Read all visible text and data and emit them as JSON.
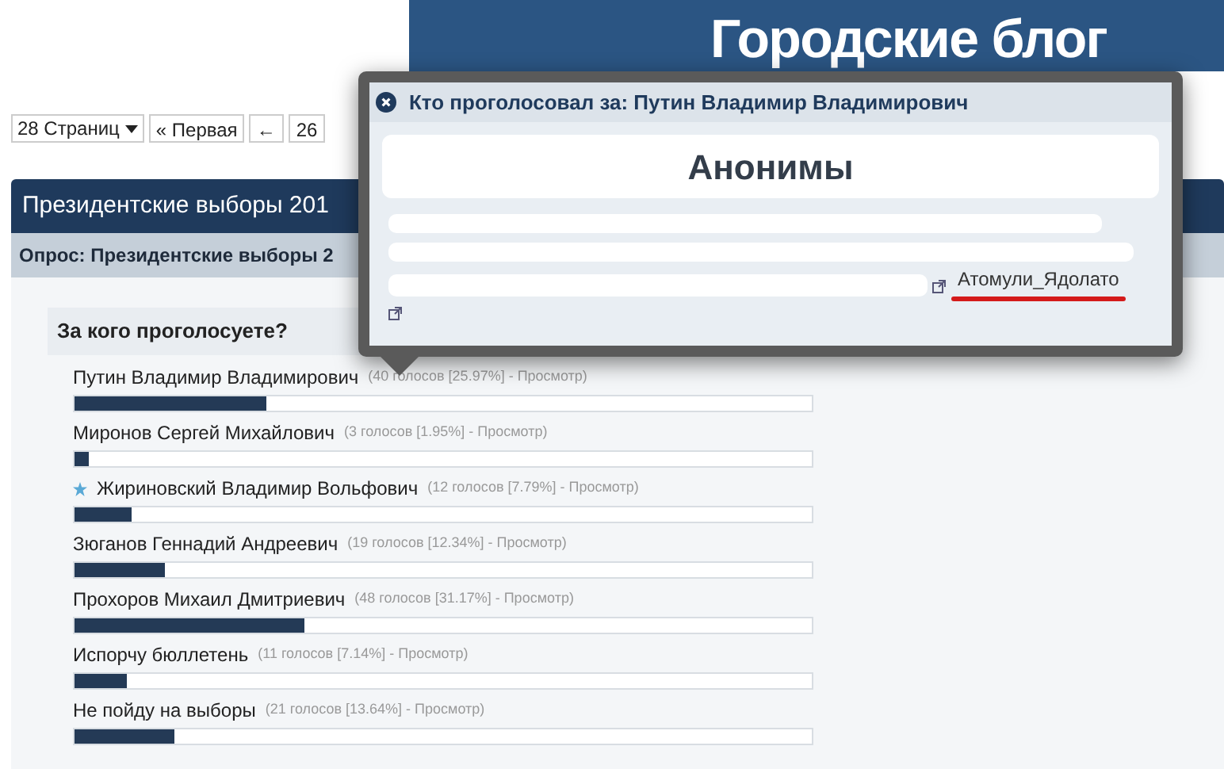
{
  "banner": {
    "title": "Городские блог"
  },
  "pagination": {
    "pages": "28 Страниц",
    "first": "« Первая",
    "prev": "←",
    "page_buttons": [
      "26"
    ]
  },
  "section": {
    "title": "Президентские выборы 201",
    "poll_title": "Опрос: Президентские выборы 2"
  },
  "poll": {
    "question": "За кого проголосуете?",
    "options": [
      {
        "name": "Путин Владимир Владимирович",
        "votes": "(40 голосов [25.97%] - Просмотр)",
        "level": 0.2597,
        "starred": false
      },
      {
        "name": "Миронов Сергей Михайлович",
        "votes": "(3 голосов [1.95%] - Просмотр)",
        "level": 0.0195,
        "starred": false
      },
      {
        "name": "Жириновский Владимир Вольфович",
        "votes": "(12 голосов [7.79%] - Просмотр)",
        "level": 0.0779,
        "starred": true
      },
      {
        "name": "Зюганов Геннадий Андреевич",
        "votes": "(19 голосов [12.34%] - Просмотр)",
        "level": 0.1234,
        "starred": false
      },
      {
        "name": "Прохоров Михаил Дмитриевич",
        "votes": "(48 голосов [31.17%] - Просмотр)",
        "level": 0.3117,
        "starred": false
      },
      {
        "name": "Испорчу бюллетень",
        "votes": "(11 голосов [7.14%] - Просмотр)",
        "level": 0.0714,
        "starred": false
      },
      {
        "name": "Не пойду на выборы",
        "votes": "(21 голосов [13.64%] - Просмотр)",
        "level": 0.1364,
        "starred": false
      }
    ]
  },
  "popup": {
    "title": "Кто проголосовал за: Путин Владимир Владимирович",
    "overlay_label": "Анонимы",
    "voters": [
      {
        "name": "Атомули_Ядолато",
        "underlined": true
      }
    ]
  }
}
